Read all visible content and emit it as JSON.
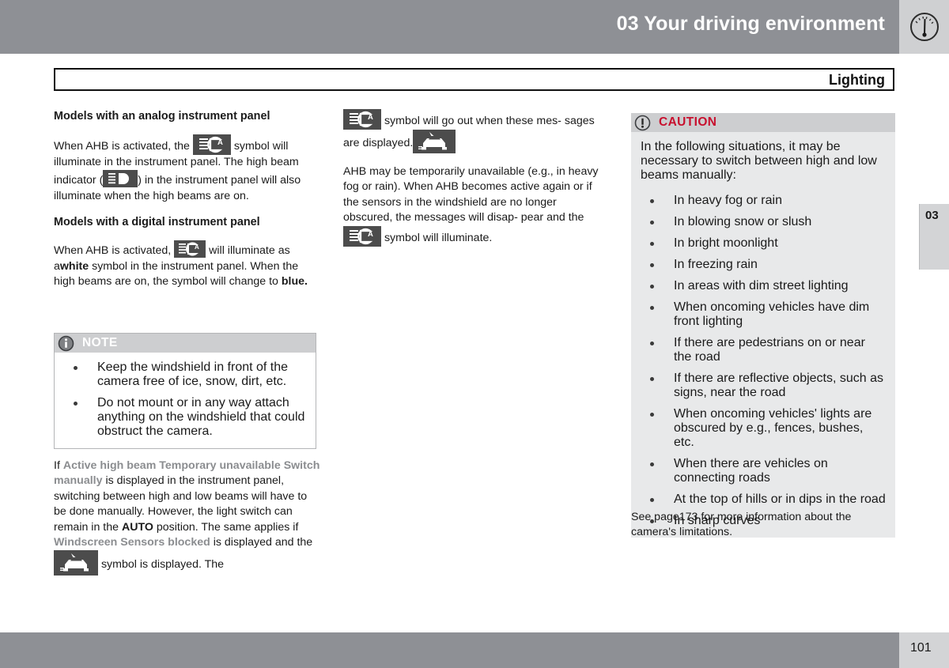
{
  "header": {
    "title": "03 Your driving environment",
    "icon": "gauge-icon"
  },
  "chapter_tab": {
    "number": "03"
  },
  "section": {
    "title": "Lighting"
  },
  "left_column": {
    "heading_analog": "Models with an analog instrument panel",
    "analog_p1_a": "When AHB is activated, the",
    "analog_p1_b": "symbol",
    "analog_p1_c": "will illuminate in the instrument panel. The",
    "analog_p1_d": "high beam indicator (",
    "analog_p1_e": ") in the instrument",
    "analog_p1_f": "panel will also illuminate when the high beams are on.",
    "heading_digital": "Models with a digital instrument panel",
    "digital_p1_a": "When AHB is activated,",
    "digital_p1_b": "will illuminate",
    "digital_p1_c": "as a",
    "digital_p1_white": "white",
    "digital_p1_d": "symbol in the instrument panel. When the high beams are on, the symbol will change to",
    "digital_p1_blue": "blue."
  },
  "note_box": {
    "icon": "info-icon",
    "title": "NOTE",
    "items": [
      "Keep the windshield in front of the camera free of ice, snow, dirt, etc.",
      "Do not mount or in any way attach anything on the windshield that could obstruct the camera."
    ]
  },
  "lower_left": {
    "a": "If",
    "msg1": "Active high beam Temporary unavailable Switch manually",
    "b": "is displayed in the instrument panel, switching between high and low beams will have to be done manually. However, the light switch can remain in the",
    "auto": "AUTO",
    "c": "position. The same applies if",
    "msg2": "Windscreen Sensors blocked",
    "d": "is displayed",
    "e": "and the",
    "f": "symbol is displayed. The"
  },
  "mid_column": {
    "p1_a": "symbol will go out when these mes-",
    "p1_b": "sages are displayed.",
    "p2_a": "AHB may be temporarily unavailable (e.g., in heavy fog or rain). When AHB becomes active again or if the sensors in the windshield are no longer obscured, the messages will disap-",
    "p2_b": "pear and the",
    "p2_c": "symbol will illuminate."
  },
  "caution_box": {
    "icon": "exclamation-icon",
    "title": "CAUTION",
    "intro": "In the following situations, it may be necessary to switch between high and low beams manually:",
    "items": [
      "In heavy fog or rain",
      "In blowing snow or slush",
      "In bright moonlight",
      "In freezing rain",
      "In areas with dim street lighting",
      "When oncoming vehicles have dim front lighting",
      "If there are pedestrians on or near the road",
      "If there are reflective objects, such as signs, near the road",
      "When oncoming vehicles' lights are obscured by e.g., fences, bushes, etc.",
      "When there are vehicles on connecting roads",
      "At the top of hills or in dips in the road",
      "In sharp curves"
    ]
  },
  "see_page": {
    "text": "See page173 for more information about the camera's limitations."
  },
  "footer": {
    "page_number": "101"
  },
  "colors": {
    "header_gray": "#8e9095",
    "tab_gray": "#d3d4d6",
    "caution_red": "#c8102e",
    "shaded_gray": "#e8e9ea",
    "symbol_chip": "#4c4c4c",
    "gray_bold_text": "#8b8d90"
  }
}
